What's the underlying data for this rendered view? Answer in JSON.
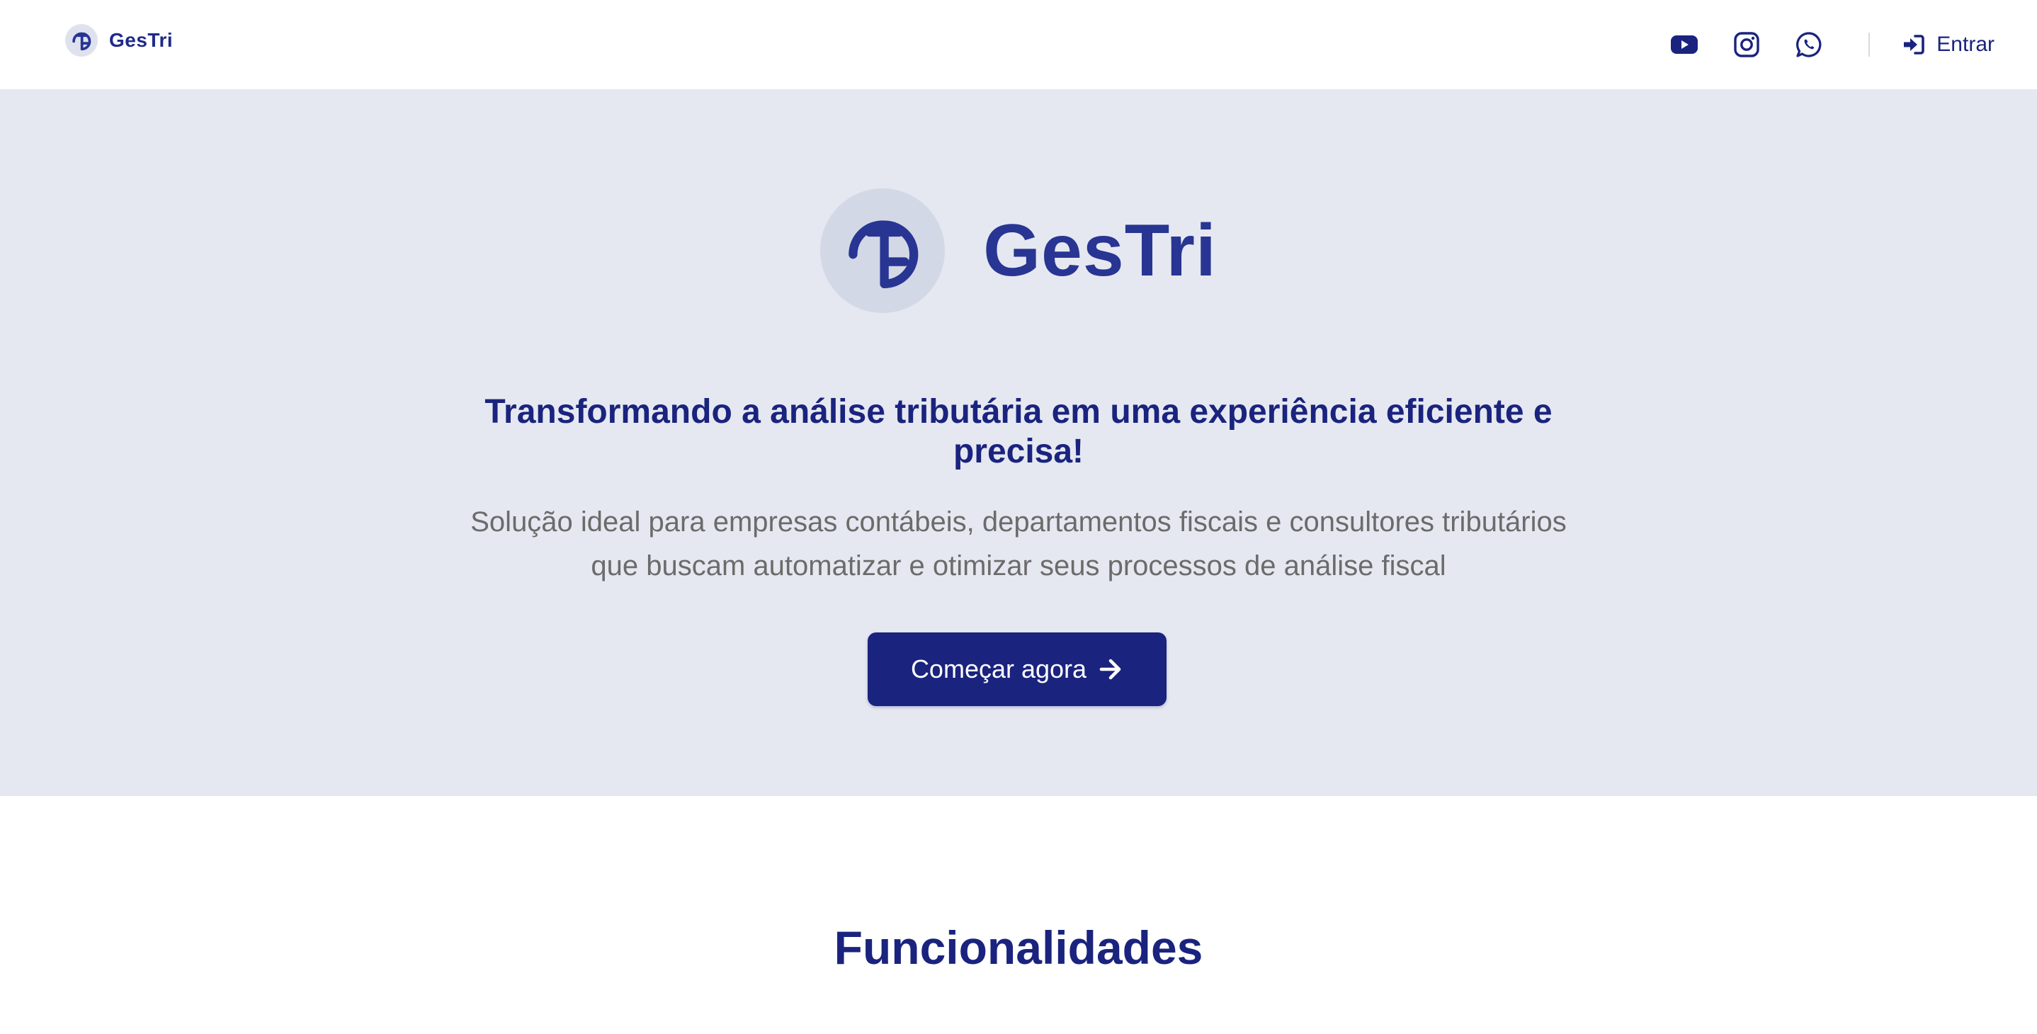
{
  "header": {
    "brand_name": "GesTri",
    "social": [
      {
        "icon": "youtube-icon"
      },
      {
        "icon": "instagram-icon"
      },
      {
        "icon": "whatsapp-icon"
      }
    ],
    "login_label": "Entrar",
    "login_icon": "sign-in-icon"
  },
  "hero": {
    "brand_name": "GesTri",
    "heading": "Transformando a análise tributária em uma experiência eficiente e precisa!",
    "subheading": "Solução ideal para empresas contábeis, departamentos fiscais e consultores tributários que buscam automatizar e otimizar seus processos de análise fiscal",
    "cta_label": "Começar agora",
    "cta_icon": "arrow-right-icon"
  },
  "features": {
    "title": "Funcionalidades"
  },
  "colors": {
    "primary": "#1a237e",
    "brand_text": "#283593",
    "hero_background": "#e5e8f0",
    "logo_circle": "#d3d8e6",
    "subtext": "#6b6b6b"
  }
}
